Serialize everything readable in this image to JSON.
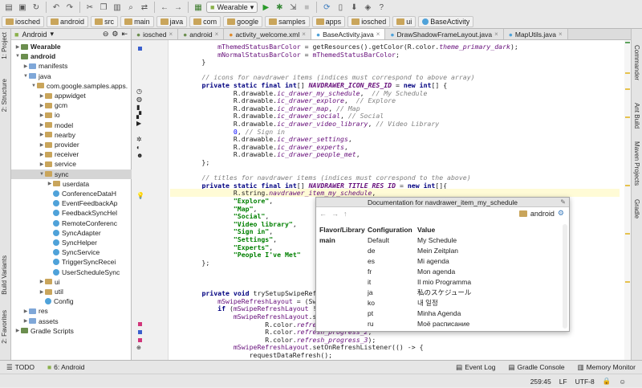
{
  "toolbar": {
    "run_config": "Wearable"
  },
  "breadcrumbs": [
    "iosched",
    "android",
    "src",
    "main",
    "java",
    "com",
    "google",
    "samples",
    "apps",
    "iosched",
    "ui",
    "BaseActivity"
  ],
  "left_tabs": [
    "1: Project",
    "2: Structure",
    "Build Variants",
    "2: Favorites"
  ],
  "right_tabs": [
    "Commander",
    "Ant Build",
    "Maven Projects",
    "Gradle"
  ],
  "project": {
    "view": "Android",
    "items": [
      {
        "label": "Wearable",
        "icon": "module-icon",
        "depth": 0,
        "expanded": false,
        "bold": true
      },
      {
        "label": "android",
        "icon": "module-icon",
        "depth": 0,
        "expanded": true,
        "bold": true
      },
      {
        "label": "manifests",
        "icon": "folder-icon",
        "depth": 1,
        "expanded": false
      },
      {
        "label": "java",
        "icon": "folder-icon",
        "depth": 1,
        "expanded": true
      },
      {
        "label": "com.google.samples.apps.",
        "icon": "package-icon",
        "depth": 2,
        "expanded": true
      },
      {
        "label": "appwidget",
        "icon": "package-icon",
        "depth": 3,
        "expanded": false
      },
      {
        "label": "gcm",
        "icon": "package-icon",
        "depth": 3,
        "expanded": false
      },
      {
        "label": "io",
        "icon": "package-icon",
        "depth": 3,
        "expanded": false
      },
      {
        "label": "model",
        "icon": "package-icon",
        "depth": 3,
        "expanded": false
      },
      {
        "label": "nearby",
        "icon": "package-icon",
        "depth": 3,
        "expanded": false
      },
      {
        "label": "provider",
        "icon": "package-icon",
        "depth": 3,
        "expanded": false
      },
      {
        "label": "receiver",
        "icon": "package-icon",
        "depth": 3,
        "expanded": false
      },
      {
        "label": "service",
        "icon": "package-icon",
        "depth": 3,
        "expanded": false
      },
      {
        "label": "sync",
        "icon": "package-icon",
        "depth": 3,
        "expanded": true,
        "selected": true
      },
      {
        "label": "userdata",
        "icon": "package-icon",
        "depth": 4,
        "expanded": false
      },
      {
        "label": "ConferenceDataH",
        "icon": "class-icon",
        "depth": 4
      },
      {
        "label": "EventFeedbackAp",
        "icon": "class-icon",
        "depth": 4
      },
      {
        "label": "FeedbackSyncHel",
        "icon": "class-icon",
        "depth": 4
      },
      {
        "label": "RemoteConferenc",
        "icon": "class-icon",
        "depth": 4
      },
      {
        "label": "SyncAdapter",
        "icon": "class-icon",
        "depth": 4
      },
      {
        "label": "SyncHelper",
        "icon": "class-icon",
        "depth": 4
      },
      {
        "label": "SyncService",
        "icon": "class-icon",
        "depth": 4
      },
      {
        "label": "TriggerSyncRecei",
        "icon": "class-icon",
        "depth": 4
      },
      {
        "label": "UserScheduleSync",
        "icon": "class-icon",
        "depth": 4
      },
      {
        "label": "ui",
        "icon": "package-icon",
        "depth": 3,
        "expanded": false
      },
      {
        "label": "util",
        "icon": "package-icon",
        "depth": 3,
        "expanded": false
      },
      {
        "label": "Config",
        "icon": "class-icon",
        "depth": 3
      },
      {
        "label": "res",
        "icon": "folder-icon",
        "depth": 1,
        "expanded": false
      },
      {
        "label": "assets",
        "icon": "folder-icon",
        "depth": 1,
        "expanded": false
      },
      {
        "label": "Gradle Scripts",
        "icon": "gradle-icon",
        "depth": 0,
        "expanded": false
      }
    ]
  },
  "tabs": [
    "iosched",
    "android",
    "activity_welcome.xml",
    "BaseActivity.java",
    "DrawShadowFrameLayout.java",
    "MapUtils.java"
  ],
  "active_tab": "BaseActivity.java",
  "code": [
    "            mThemedStatusBarColor = getResources().getColor(R.color.theme_primary_dark);",
    "            mNormalStatusBarColor = mThemedStatusBarColor;",
    "        }",
    "",
    "        // icons for navdrawer items (indices must correspond to above array)",
    "        private static final int[] NAVDRAWER_ICON_RES_ID = new int[] {",
    "                R.drawable.ic_drawer_my_schedule,  // My Schedule",
    "                R.drawable.ic_drawer_explore,  // Explore",
    "                R.drawable.ic_drawer_map, // Map",
    "                R.drawable.ic_drawer_social, // Social",
    "                R.drawable.ic_drawer_video_library, // Video Library",
    "                0, // Sign in",
    "                R.drawable.ic_drawer_settings,",
    "                R.drawable.ic_drawer_experts,",
    "                R.drawable.ic_drawer_people_met,",
    "        };",
    "",
    "        // titles for navdrawer items (indices must correspond to the above)",
    "        private static final int[] NAVDRAWER_TITLE_RES_ID = new int[]{",
    "                R.string.navdrawer_item_my_schedule,",
    "                \"Explore\",",
    "                \"Map\",",
    "                \"Social\",",
    "                \"Video library\",",
    "                \"Sign in\",",
    "                \"Settings\",",
    "                \"Experts\",",
    "                \"People I've Met\"",
    "        };",
    "",
    "",
    "",
    "        private void trySetupSwipeRefresh() {",
    "            mSwipeRefreshLayout = (SwipeRefreshL",
    "            if (mSwipeRefreshLayout != null) {",
    "                mSwipeRefreshLayout.setColorSche",
    "                        R.color.refresh_progress",
    "                        R.color.refresh_progress_2,",
    "                        R.color.refresh_progress_3);",
    "                mSwipeRefreshLayout.setOnRefreshListener(() -> {",
    "                    requestDataRefresh();"
  ],
  "doc_popup": {
    "title": "Documentation for navdrawer_item_my_schedule",
    "module": "android",
    "headers": [
      "Flavor/Library",
      "Configuration",
      "Value"
    ],
    "rows": [
      [
        "main",
        "Default",
        "My Schedule"
      ],
      [
        "",
        "de",
        "Mein Zeitplan"
      ],
      [
        "",
        "es",
        "Mi agenda"
      ],
      [
        "",
        "fr",
        "Mon agenda"
      ],
      [
        "",
        "it",
        "Il mio Programma"
      ],
      [
        "",
        "ja",
        "私のスケジュール"
      ],
      [
        "",
        "ko",
        "내 일정"
      ],
      [
        "",
        "pt",
        "Minha Agenda"
      ],
      [
        "",
        "ru",
        "Моё расписание"
      ]
    ]
  },
  "status": {
    "tool_tabs": [
      "TODO",
      "6: Android"
    ],
    "right_tools": [
      "Event Log",
      "Gradle Console",
      "Memory Monitor"
    ],
    "position": "259:45",
    "line_sep": "LF",
    "encoding": "UTF-8"
  }
}
